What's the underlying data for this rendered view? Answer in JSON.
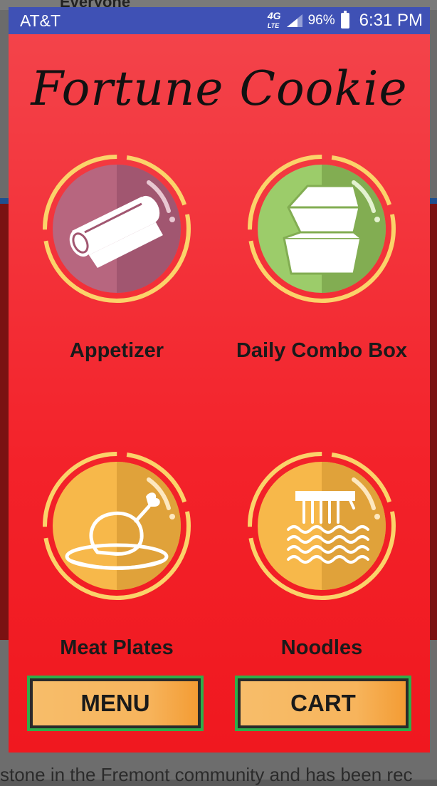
{
  "background": {
    "top_text": "Everyone",
    "bottom_text": "stone in the Fremont community and has been rec"
  },
  "status_bar": {
    "carrier": "AT&T",
    "network": "4G",
    "network_sub": "LTE",
    "battery_percent": "96%",
    "time": "6:31 PM",
    "color": "#3f51b5"
  },
  "app": {
    "title": "Fortune Cookie",
    "background_color": "#f3222a",
    "categories": [
      {
        "label": "Appetizer",
        "icon": "spring-roll-icon",
        "circle_color": "#b7667f"
      },
      {
        "label": "Daily Combo Box",
        "icon": "takeout-box-icon",
        "circle_color": "#8fbf5c"
      },
      {
        "label": "Meat Plates",
        "icon": "roast-chicken-icon",
        "circle_color": "#f7b84a"
      },
      {
        "label": "Noodles",
        "icon": "noodles-icon",
        "circle_color": "#f7b84a"
      }
    ],
    "buttons": {
      "menu": "MENU",
      "cart": "CART",
      "border_color": "#2fae4a"
    }
  }
}
